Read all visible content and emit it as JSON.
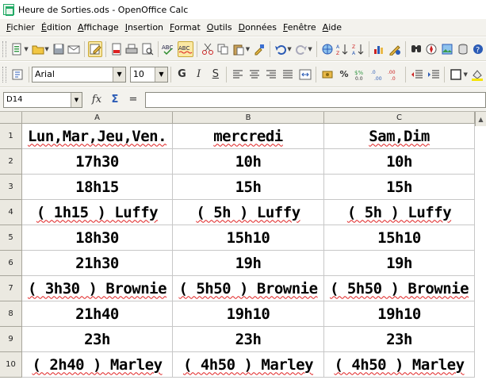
{
  "window": {
    "title": "Heure de Sorties.ods - OpenOffice Calc"
  },
  "menubar": {
    "items": [
      "Fichier",
      "Édition",
      "Affichage",
      "Insertion",
      "Format",
      "Outils",
      "Données",
      "Fenêtre",
      "Aide"
    ]
  },
  "format_toolbar": {
    "font_name": "Arial",
    "font_size": "10"
  },
  "formula_bar": {
    "name_box": "D14",
    "fx_icon": "fx",
    "sum_icon": "Σ",
    "equals": "=",
    "formula": ""
  },
  "columns": [
    "A",
    "B",
    "C"
  ],
  "rows": [
    {
      "num": "1",
      "cells": [
        "Lun,Mar,Jeu,Ven.",
        "mercredi",
        "Sam,Dim"
      ]
    },
    {
      "num": "2",
      "cells": [
        "17h30",
        "10h",
        "10h"
      ]
    },
    {
      "num": "3",
      "cells": [
        "18h15",
        "15h",
        "15h"
      ]
    },
    {
      "num": "4",
      "cells": [
        "( 1h15 ) Luffy",
        "( 5h ) Luffy",
        "( 5h ) Luffy"
      ]
    },
    {
      "num": "5",
      "cells": [
        "18h30",
        "15h10",
        "15h10"
      ]
    },
    {
      "num": "6",
      "cells": [
        "21h30",
        "19h",
        "19h"
      ]
    },
    {
      "num": "7",
      "cells": [
        "( 3h30 ) Brownie",
        "( 5h50 ) Brownie",
        "( 5h50 ) Brownie"
      ]
    },
    {
      "num": "8",
      "cells": [
        "21h40",
        "19h10",
        "19h10"
      ]
    },
    {
      "num": "9",
      "cells": [
        "23h",
        "23h",
        "23h"
      ]
    },
    {
      "num": "10",
      "cells": [
        "( 2h40 ) Marley",
        "( 4h50 ) Marley",
        "( 4h50 ) Marley"
      ]
    }
  ],
  "spellcheck_rows": [
    "1",
    "4",
    "7",
    "10"
  ]
}
